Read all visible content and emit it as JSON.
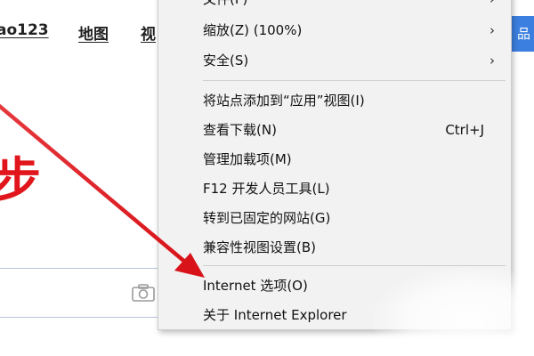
{
  "background": {
    "nav_links": [
      "ao123",
      "地图",
      "视"
    ],
    "big_text": "步",
    "button_text": "品"
  },
  "menu": {
    "items": [
      {
        "label": "文件(F)",
        "has_submenu": true,
        "shortcut": ""
      },
      {
        "label": "缩放(Z) (100%)",
        "has_submenu": true,
        "shortcut": ""
      },
      {
        "label": "安全(S)",
        "has_submenu": true,
        "shortcut": ""
      },
      {
        "label": "将站点添加到“应用”视图(I)",
        "has_submenu": false,
        "shortcut": ""
      },
      {
        "label": "查看下载(N)",
        "has_submenu": false,
        "shortcut": "Ctrl+J"
      },
      {
        "label": "管理加载项(M)",
        "has_submenu": false,
        "shortcut": ""
      },
      {
        "label": "F12 开发人员工具(L)",
        "has_submenu": false,
        "shortcut": ""
      },
      {
        "label": "转到已固定的网站(G)",
        "has_submenu": false,
        "shortcut": ""
      },
      {
        "label": "兼容性视图设置(B)",
        "has_submenu": false,
        "shortcut": ""
      },
      {
        "label": "Internet 选项(O)",
        "has_submenu": false,
        "shortcut": ""
      },
      {
        "label": "关于 Internet Explorer",
        "has_submenu": false,
        "shortcut": ""
      }
    ]
  },
  "colors": {
    "annotation": "#e0161c",
    "menu_background": "#f2f2f2",
    "accent_button": "#3b7fe0"
  },
  "icons": {
    "submenu": "chevron-right-icon",
    "camera": "camera-icon",
    "annotation": "arrow-annotation"
  }
}
